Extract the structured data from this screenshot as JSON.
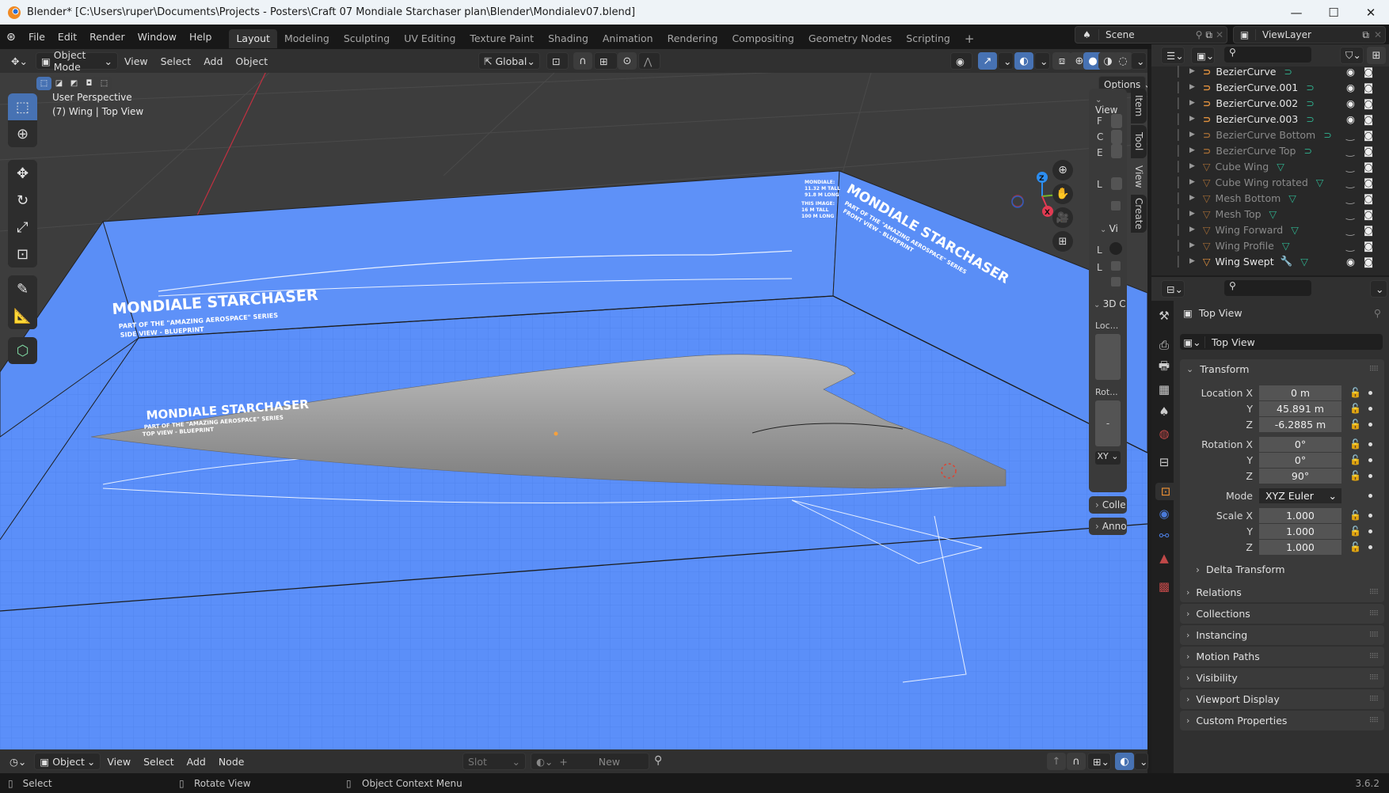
{
  "window": {
    "title": "Blender* [C:\\Users\\ruper\\Documents\\Projects - Posters\\Craft 07 Mondiale Starchaser plan\\Blender\\Mondialev07.blend]",
    "controls": {
      "minimize": "—",
      "maximize": "☐",
      "close": "✕"
    }
  },
  "topbar": {
    "menus": [
      "File",
      "Edit",
      "Render",
      "Window",
      "Help"
    ],
    "workspaces": [
      "Layout",
      "Modeling",
      "Sculpting",
      "UV Editing",
      "Texture Paint",
      "Shading",
      "Animation",
      "Rendering",
      "Compositing",
      "Geometry Nodes",
      "Scripting"
    ],
    "active_workspace": "Layout",
    "add_workspace": "+",
    "scene": "Scene",
    "view_layer": "ViewLayer"
  },
  "viewport_header": {
    "mode": "Object Mode",
    "menus": [
      "View",
      "Select",
      "Add",
      "Object"
    ],
    "orientation": "Global",
    "options_label": "Options"
  },
  "viewport": {
    "perspective_label": "User Perspective",
    "object_label": "(7) Wing | Top View",
    "gizmo": {
      "x": "X",
      "y": "Y",
      "z": "Z"
    },
    "blueprint": {
      "side_title": "MONDIALE STARCHASER",
      "side_sub1": "PART OF THE \"AMAZING AEROSPACE\" SERIES",
      "side_sub2": "SIDE VIEW - BLUEPRINT",
      "top_title": "MONDIALE STARCHASER",
      "top_sub1": "PART OF THE \"AMAZING AEROSPACE\" SERIES",
      "top_sub2": "TOP VIEW - BLUEPRINT",
      "front_title": "MONDIALE STARCHASER",
      "front_sub1": "PART OF THE \"AMAZING AEROSPACE\" SERIES",
      "front_sub2": "FRONT VIEW - BLUEPRINT",
      "dims": [
        "MONDIALE:",
        "11.32 M TALL",
        "91.8 M LONG",
        "THIS IMAGE:",
        "16 M TALL",
        "100 M LONG"
      ]
    },
    "colors": {
      "blueprint": "#5b8ff9",
      "background": "#3d3d3d",
      "mesh": "#9a9a9a"
    }
  },
  "npanel": {
    "tabs": [
      "Item",
      "Tool",
      "View",
      "Create"
    ],
    "active_tab": "View",
    "view_header": "View",
    "view_rows": [
      "F",
      "C",
      "E",
      "L"
    ],
    "vi_header": "Vi",
    "vi_rows": [
      "L",
      "L"
    ],
    "cursor_header": "3D C",
    "loc_label": "Loc...",
    "rot_label": "Rot...",
    "rot_mid": "-",
    "rot_mode": "XY",
    "collapsed": [
      "Colle",
      "Anno"
    ]
  },
  "shader_header": {
    "mode": "Object",
    "menus": [
      "View",
      "Select",
      "Add",
      "Node"
    ],
    "slot": "Slot",
    "new_label": "New"
  },
  "statusbar": {
    "items": [
      "Select",
      "Rotate View",
      "Object Context Menu"
    ],
    "version": "3.6.2"
  },
  "outliner": {
    "items": [
      {
        "name": "BezierCurve",
        "type": "curve",
        "visible": true
      },
      {
        "name": "BezierCurve.001",
        "type": "curve",
        "visible": true
      },
      {
        "name": "BezierCurve.002",
        "type": "curve",
        "visible": true
      },
      {
        "name": "BezierCurve.003",
        "type": "curve",
        "visible": true
      },
      {
        "name": "BezierCurve Bottom",
        "type": "curve",
        "visible": false
      },
      {
        "name": "BezierCurve Top",
        "type": "curve",
        "visible": false
      },
      {
        "name": "Cube Wing",
        "type": "mesh",
        "visible": false
      },
      {
        "name": "Cube Wing rotated",
        "type": "mesh",
        "visible": false
      },
      {
        "name": "Mesh Bottom",
        "type": "mesh",
        "visible": false
      },
      {
        "name": "Mesh Top",
        "type": "mesh",
        "visible": false
      },
      {
        "name": "Wing Forward",
        "type": "mesh",
        "visible": false
      },
      {
        "name": "Wing Profile",
        "type": "mesh",
        "visible": false
      },
      {
        "name": "Wing Swept",
        "type": "mesh",
        "visible": true,
        "modifier": true
      }
    ]
  },
  "properties": {
    "object_name": "Top View",
    "datablock_name": "Top View",
    "transform_header": "Transform",
    "location": {
      "label": "Location X",
      "x": "0 m",
      "y": "45.891 m",
      "z": "-6.2885 m"
    },
    "rotation": {
      "label": "Rotation X",
      "x": "0°",
      "y": "0°",
      "z": "90°"
    },
    "mode_label": "Mode",
    "mode_value": "XYZ Euler",
    "scale": {
      "label": "Scale X",
      "x": "1.000",
      "y": "1.000",
      "z": "1.000"
    },
    "axis_y": "Y",
    "axis_z": "Z",
    "delta_transform": "Delta Transform",
    "panels": [
      "Relations",
      "Collections",
      "Instancing",
      "Motion Paths",
      "Visibility",
      "Viewport Display",
      "Custom Properties"
    ]
  }
}
